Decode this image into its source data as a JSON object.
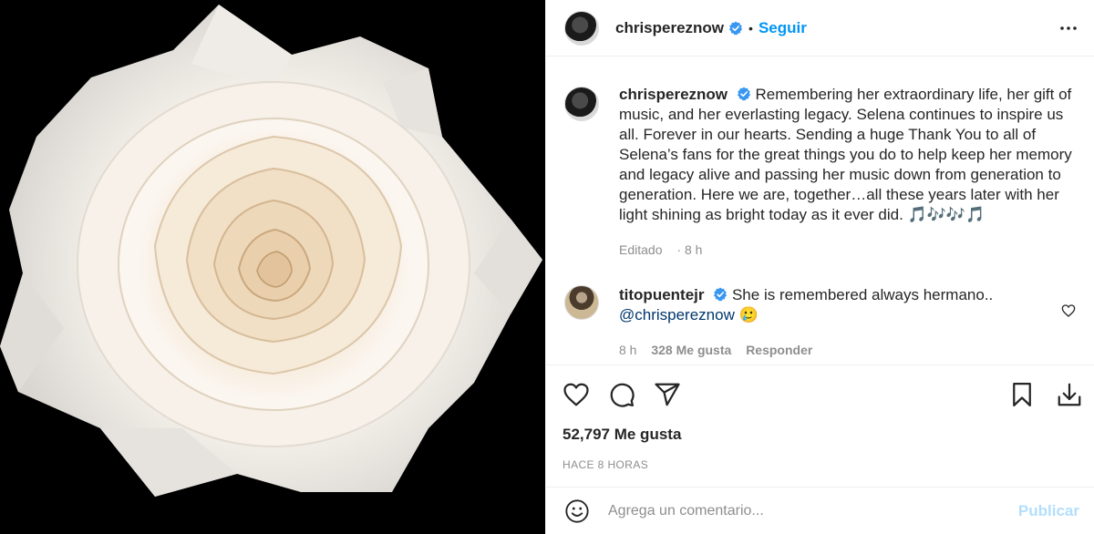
{
  "post": {
    "author": "chrispereznow",
    "follow_label": "Seguir",
    "dot": "•",
    "caption": "Remembering her extraordinary life, her gift of music, and her everlasting legacy. Selena continues to inspire us all. Forever in our hearts. Sending a huge Thank You to all of Selena’s fans for the great things you do to help keep her memory and legacy alive and passing her music down from generation to generation. Here we are, together…all these years later with her light shining as bright today as it ever did. 🎵🎶🎶🎵",
    "caption_meta_edited": "Editado",
    "caption_meta_time": "8 h"
  },
  "reply": {
    "author": "titopuentejr",
    "text": "She is remembered always hermano..",
    "mention": "@chrispereznow",
    "emoji": "🥲",
    "time": "8 h",
    "likes": "328 Me gusta",
    "reply_label": "Responder"
  },
  "stats": {
    "likes": "52,797 Me gusta",
    "time": "HACE 8 HORAS"
  },
  "composer": {
    "placeholder": "Agrega un comentario...",
    "publish_label": "Publicar"
  },
  "colors": {
    "accent": "#0095f6",
    "publish_disabled": "#b2dffc",
    "verified": "#3897f0",
    "muted": "#8e8e8e",
    "border": "#efefef"
  },
  "icons": [
    "more-options-icon",
    "verified-badge-icon",
    "heart-icon",
    "comment-icon",
    "share-icon",
    "bookmark-icon",
    "download-icon",
    "emoji-icon"
  ]
}
